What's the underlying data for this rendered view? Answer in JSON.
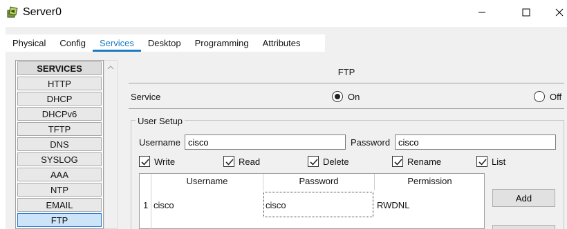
{
  "window": {
    "title": "Server0",
    "icons": {
      "app": "server-icon",
      "minimize": "minimize-icon",
      "maximize": "maximize-icon",
      "close": "close-icon"
    }
  },
  "tabs": [
    {
      "label": "Physical",
      "active": false
    },
    {
      "label": "Config",
      "active": false
    },
    {
      "label": "Services",
      "active": true
    },
    {
      "label": "Desktop",
      "active": false
    },
    {
      "label": "Programming",
      "active": false
    },
    {
      "label": "Attributes",
      "active": false
    }
  ],
  "services": {
    "header": "SERVICES",
    "items": [
      "HTTP",
      "DHCP",
      "DHCPv6",
      "TFTP",
      "DNS",
      "SYSLOG",
      "AAA",
      "NTP",
      "EMAIL",
      "FTP"
    ],
    "selected": "FTP"
  },
  "ftp": {
    "title": "FTP",
    "service_label": "Service",
    "on_label": "On",
    "off_label": "Off",
    "service_state": "On"
  },
  "user_setup": {
    "title": "User Setup",
    "username_label": "Username",
    "username_value": "cisco",
    "password_label": "Password",
    "password_value": "cisco",
    "permissions": [
      {
        "label": "Write",
        "checked": true
      },
      {
        "label": "Read",
        "checked": true
      },
      {
        "label": "Delete",
        "checked": true
      },
      {
        "label": "Rename",
        "checked": true
      },
      {
        "label": "List",
        "checked": true
      }
    ],
    "table": {
      "columns": [
        "Username",
        "Password",
        "Permission"
      ],
      "rows": [
        {
          "index": "1",
          "username": "cisco",
          "password": "cisco",
          "permission": "RWDNL"
        }
      ]
    },
    "add_label": "Add"
  },
  "colors": {
    "accent": "#1a7bc4",
    "selected_item_bg": "#cce4f7",
    "selected_item_border": "#2b7bd4",
    "panel_bg": "#f0f0f0"
  }
}
